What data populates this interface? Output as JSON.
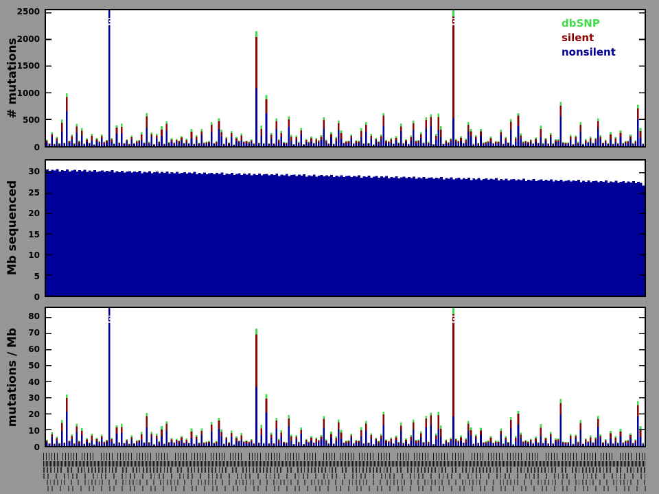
{
  "figure": {
    "background_color": "#969696",
    "plot_background": "#ffffff",
    "axis_color": "#000000",
    "colors": {
      "nonsilent": "#000099",
      "silent": "#8b0000",
      "dbsnp": "#3fdd4a",
      "coverage": "#000099",
      "clip_mark": "#ffffff"
    }
  },
  "legend": {
    "items": [
      {
        "label": "dbSNP",
        "color": "#3fdd4a"
      },
      {
        "label": "silent",
        "color": "#8b0000"
      },
      {
        "label": "nonsilent",
        "color": "#000099"
      }
    ]
  },
  "x_axis": {
    "labels": "~240 per-sample identifiers rendered vertically (rotated 90deg), too small to be legible at this resolution"
  },
  "samples": {
    "count": 240,
    "total_pattern16": [
      120,
      75,
      210,
      55,
      160,
      95,
      310,
      65,
      140,
      85,
      260,
      50,
      185,
      105,
      340,
      70
    ],
    "mult_pattern7": [
      1.0,
      0.7,
      1.25,
      0.85,
      1.1,
      0.6,
      0.95
    ],
    "nonsilent_frac5": [
      0.58,
      0.5,
      0.66,
      0.45,
      0.6
    ],
    "silent_frac5": [
      0.27,
      0.33,
      0.2,
      0.38,
      0.25
    ],
    "mb_start": 30.7,
    "mb_end": 27.7,
    "mb_jitter11": [
      0.15,
      -0.2,
      0.1,
      -0.1,
      0.25,
      -0.3,
      0.05,
      -0.15,
      0.2,
      -0.25,
      0
    ],
    "mb_overrides": {
      "239": 26.9
    },
    "peaks": {
      "6": [
        280,
        160,
        60
      ],
      "8": [
        660,
        260,
        70
      ],
      "12": [
        260,
        110,
        50
      ],
      "25": [
        2600,
        90,
        50
      ],
      "28": [
        240,
        110,
        40
      ],
      "40": [
        350,
        210,
        60
      ],
      "48": [
        290,
        130,
        50
      ],
      "66": [
        270,
        130,
        50
      ],
      "69": [
        320,
        150,
        50
      ],
      "84": [
        1090,
        960,
        110
      ],
      "88": [
        620,
        260,
        80
      ],
      "92": [
        320,
        150,
        50
      ],
      "97": [
        360,
        140,
        60
      ],
      "111": [
        330,
        160,
        50
      ],
      "117": [
        300,
        130,
        50
      ],
      "128": [
        280,
        120,
        50
      ],
      "135": [
        380,
        190,
        50
      ],
      "147": [
        300,
        130,
        50
      ],
      "152": [
        330,
        160,
        50
      ],
      "154": [
        380,
        170,
        50
      ],
      "157": [
        300,
        250,
        60
      ],
      "163": [
        520,
        2120,
        90
      ],
      "169": [
        280,
        120,
        50
      ],
      "186": [
        310,
        150,
        50
      ],
      "189": [
        380,
        190,
        50
      ],
      "206": [
        560,
        200,
        70
      ],
      "214": [
        280,
        120,
        50
      ],
      "221": [
        330,
        140,
        50
      ],
      "237": [
        510,
        200,
        70
      ]
    },
    "offscale_clipped_bars": [
      25,
      163
    ],
    "green_tip_at_top": [
      163
    ]
  },
  "chart_data": [
    {
      "id": "mutations",
      "type": "bar",
      "stacked": true,
      "ylabel": "# mutations",
      "yticks": [
        0,
        500,
        1000,
        1500,
        2000,
        2500
      ],
      "ylim": [
        0,
        2550
      ],
      "legend_position": "top-right inside axes",
      "grid": false,
      "series_note": "stacked per-sample counts: nonsilent (navy, bottom) + silent (dark red) + dbSNP (green, top); two bars exceed the axis and carry white break marks"
    },
    {
      "id": "coverage",
      "type": "bar",
      "stacked": false,
      "ylabel": "Mb sequenced",
      "yticks": [
        0,
        5,
        10,
        15,
        20,
        25,
        30
      ],
      "ylim": [
        0,
        33
      ],
      "grid": false,
      "series_note": "solid navy bars ~30.7 Mb on the left declining gradually to ~27 Mb on the right"
    },
    {
      "id": "rates",
      "type": "bar",
      "stacked": true,
      "ylabel": "mutations / Mb",
      "yticks": [
        0,
        10,
        20,
        30,
        40,
        50,
        60,
        70,
        80
      ],
      "ylim": [
        0,
        86
      ],
      "grid": false,
      "series_note": "same stacked composition divided by Mb sequenced; same two bars clipped above 80"
    }
  ]
}
